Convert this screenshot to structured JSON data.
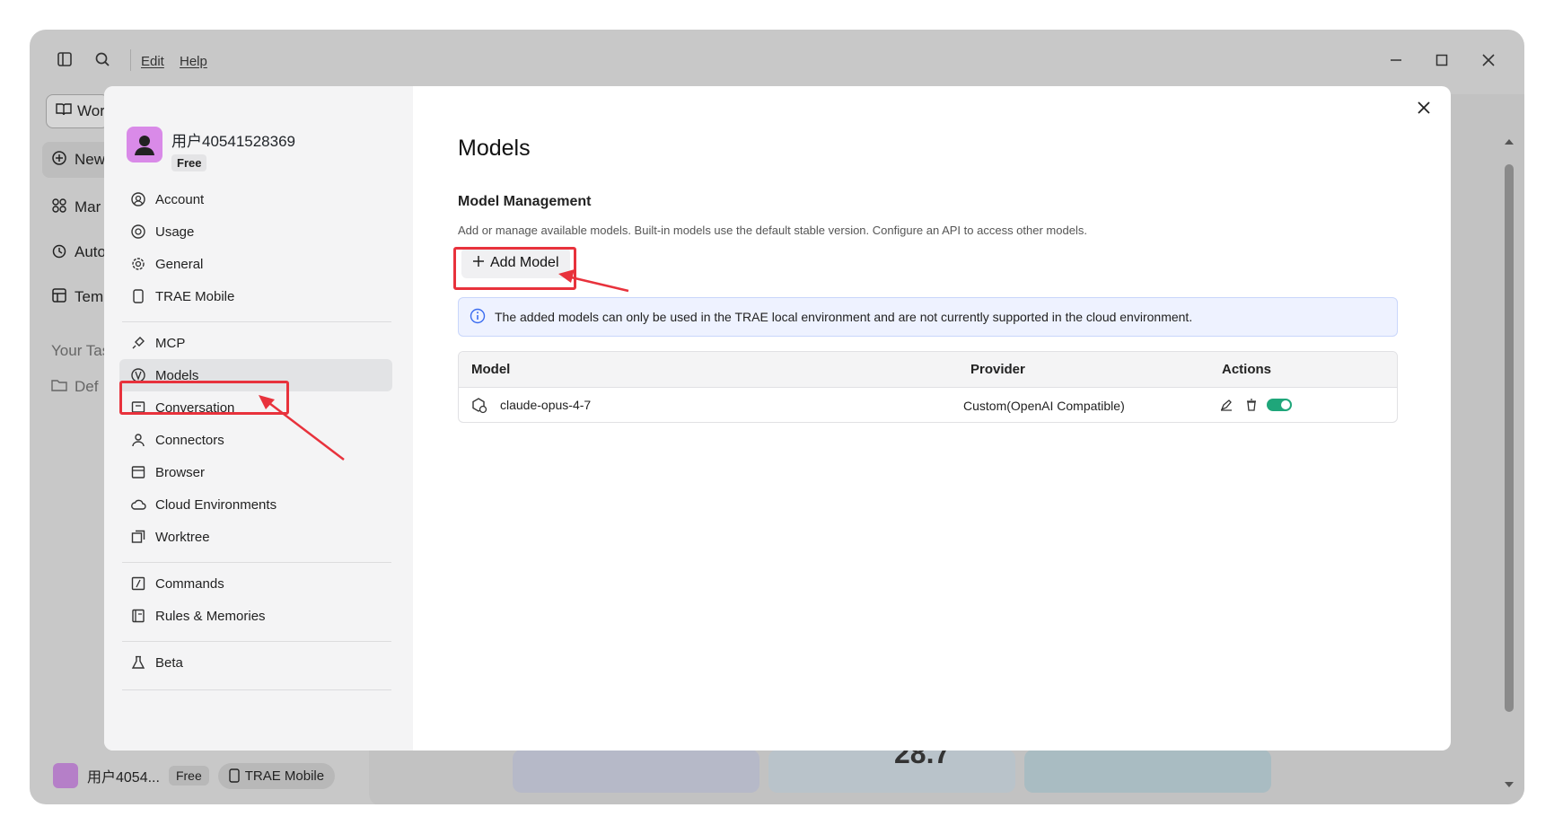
{
  "titlebar": {
    "menu": [
      "Edit",
      "Help"
    ]
  },
  "background": {
    "sidebar": [
      "Wor",
      "New",
      "Mar",
      "Auto",
      "Tem"
    ],
    "section_label": "Your Tas",
    "folder": "Def",
    "footer_user": "用户4054...",
    "footer_plan": "Free",
    "footer_mobile": "TRAE Mobile",
    "card_number": "28.7"
  },
  "user": {
    "name": "用户40541528369",
    "plan": "Free"
  },
  "nav": {
    "group1": [
      "Account",
      "Usage",
      "General",
      "TRAE Mobile"
    ],
    "group2": [
      "MCP",
      "Models",
      "Conversation",
      "Connectors",
      "Browser",
      "Cloud Environments",
      "Worktree"
    ],
    "group3": [
      "Commands",
      "Rules & Memories"
    ],
    "group4": [
      "Beta"
    ]
  },
  "main": {
    "title": "Models",
    "subtitle": "Model Management",
    "description": "Add or manage available models. Built-in models use the default stable version. Configure an API to access other models.",
    "add_button": "Add Model",
    "info": "The added models can only be used in the TRAE local environment and are not currently supported in the cloud environment.",
    "table": {
      "headers": [
        "Model",
        "Provider",
        "Actions"
      ],
      "rows": [
        {
          "model": "claude-opus-4-7",
          "provider": "Custom(OpenAI Compatible)",
          "enabled": true
        }
      ]
    }
  },
  "colors": {
    "accent_toggle": "#1fa67a",
    "annotation": "#e8323c",
    "info_bg": "#eef2ff"
  }
}
